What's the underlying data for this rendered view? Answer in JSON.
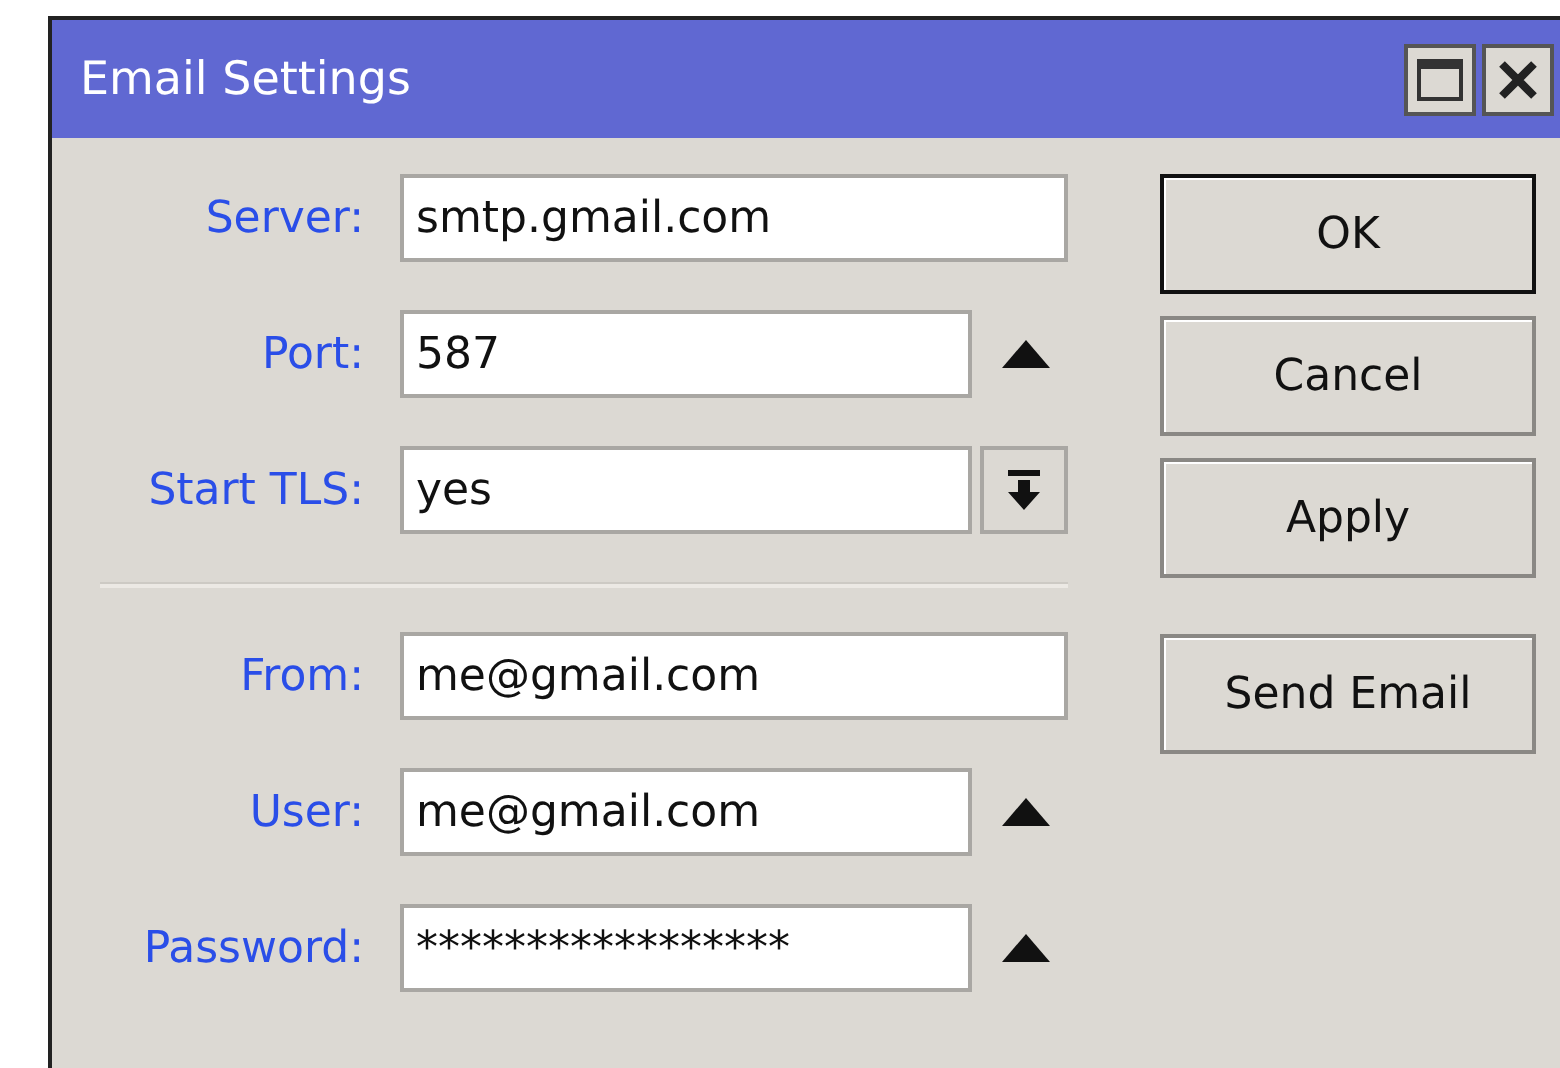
{
  "window": {
    "title": "Email Settings"
  },
  "groups": [
    [
      {
        "label": "Server:",
        "value": "smtp.gmail.com",
        "kind": "text"
      },
      {
        "label": "Port:",
        "value": "587",
        "kind": "toggle"
      },
      {
        "label": "Start TLS:",
        "value": "yes",
        "kind": "dropdown"
      }
    ],
    [
      {
        "label": "From:",
        "value": "me@gmail.com",
        "kind": "text"
      },
      {
        "label": "User:",
        "value": "me@gmail.com",
        "kind": "toggle"
      },
      {
        "label": "Password:",
        "value": "*****************",
        "kind": "toggle"
      }
    ]
  ],
  "buttons": [
    {
      "label": "OK",
      "default": true
    },
    {
      "label": "Cancel",
      "default": false
    },
    {
      "label": "Apply",
      "default": false
    },
    {
      "label": "Send Email",
      "default": false
    }
  ]
}
